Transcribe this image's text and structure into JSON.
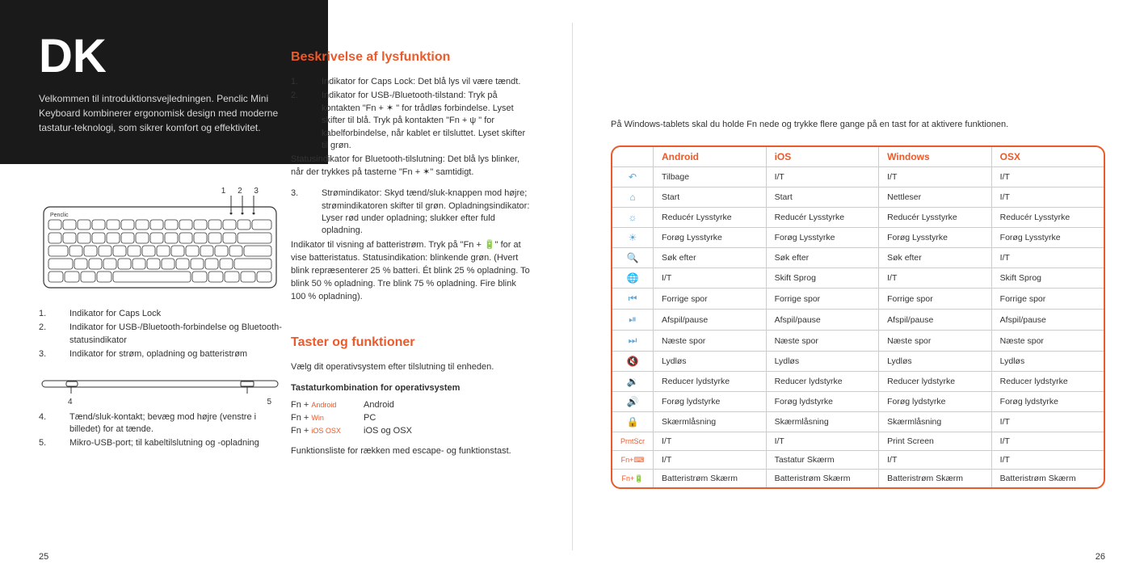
{
  "left": {
    "lang_code": "DK",
    "welcome": "Velkommen til introduktionsvejledningen. Penclic Mini Keyboard kombinerer ergonomisk design med moderne tastatur-teknologi, som sikrer komfort og effektivitet.",
    "kb_top_nums": "1   2   3",
    "kb_bottom_left": "4",
    "kb_bottom_right": "5",
    "indicators": [
      "Indikator for Caps Lock",
      "Indikator for USB-/Bluetooth-forbindelse og Bluetooth-statusindikator",
      "Indikator for strøm, opladning og batteristrøm"
    ],
    "bottom_items": [
      "Tænd/sluk-kontakt; bevæg mod højre (venstre i billedet) for at tænde.",
      "Mikro-USB-port; til kabeltilslutning og -opladning"
    ]
  },
  "mid": {
    "h_light": "Beskrivelse af lysfunktion",
    "light_items": [
      "Indikator for Caps Lock: Det blå lys vil være tændt.",
      "Indikator for USB-/Bluetooth-tilstand: Tryk på kontakten \"Fn + ✶ \" for trådløs forbindelse. Lyset skifter til blå. Tryk på kontakten \"Fn +  ψ \" for kabelforbindelse, når kablet er tilsluttet. Lyset skifter til grøn."
    ],
    "bt_status": "Statusindikator for Bluetooth-tilslutning: Det blå lys blinker, når der trykkes på tasterne \"Fn + ✶\" samtidigt.",
    "power_item": "Strømindikator: Skyd tænd/sluk-knappen mod højre; strømindikatoren skifter til grøn. Opladningsindikator: Lyser rød under opladning; slukker efter fuld opladning.",
    "battery_para": "Indikator til visning af batteristrøm. Tryk på \"Fn + 🔋\" for at vise batteristatus. Statusindikation: blinkende grøn. (Hvert blink repræsenterer 25 % batteri. Ét blink 25 % opladning. To blink 50 % opladning. Tre blink 75 % opladning. Fire blink 100 % opladning).",
    "h_keys": "Taster og funktioner",
    "choose_os": "Vælg dit operativsystem efter tilslutning til enheden.",
    "shortcut_head": "Tastaturkombination for operativsystem",
    "shortcuts": [
      {
        "combo_prefix": "Fn + ",
        "combo_os": "Android",
        "label": "Android"
      },
      {
        "combo_prefix": "Fn + ",
        "combo_os": "Win",
        "label": "PC"
      },
      {
        "combo_prefix": "Fn + ",
        "combo_os": "iOS OSX",
        "label": "iOS og OSX"
      }
    ],
    "fn_list_note": "Funktionsliste for rækken med escape- og funktionstast."
  },
  "right": {
    "intro": "På Windows-tablets skal du holde Fn nede og trykke flere gange på en tast for at aktivere funktionen.",
    "headers": [
      "",
      "Android",
      "iOS",
      "Windows",
      "OSX"
    ],
    "rows": [
      {
        "icon": "↶",
        "cells": [
          "Tilbage",
          "I/T",
          "I/T",
          "I/T"
        ]
      },
      {
        "icon": "⌂",
        "cells": [
          "Start",
          "Start",
          "Nettleser",
          "I/T"
        ]
      },
      {
        "icon": "☼",
        "cells": [
          "Reducér Lysstyrke",
          "Reducér Lysstyrke",
          "Reducér Lysstyrke",
          "Reducér Lysstyrke"
        ]
      },
      {
        "icon": "☀",
        "cells": [
          "Forøg Lysstyrke",
          "Forøg Lysstyrke",
          "Forøg Lysstyrke",
          "Forøg Lysstyrke"
        ]
      },
      {
        "icon": "🔍",
        "cells": [
          "Søk efter",
          "Søk efter",
          "Søk efter",
          "I/T"
        ]
      },
      {
        "icon": "🌐",
        "cells": [
          "I/T",
          "Skift Sprog",
          "I/T",
          "Skift Sprog"
        ]
      },
      {
        "icon": "⏮",
        "cells": [
          "Forrige spor",
          "Forrige spor",
          "Forrige spor",
          "Forrige spor"
        ]
      },
      {
        "icon": "⏯",
        "cells": [
          "Afspil/pause",
          "Afspil/pause",
          "Afspil/pause",
          "Afspil/pause"
        ]
      },
      {
        "icon": "⏭",
        "cells": [
          "Næste spor",
          "Næste spor",
          "Næste spor",
          "Næste spor"
        ]
      },
      {
        "icon": "🔇",
        "cells": [
          "Lydløs",
          "Lydløs",
          "Lydløs",
          "Lydløs"
        ]
      },
      {
        "icon": "🔉",
        "cells": [
          "Reducer lydstyrke",
          "Reducer lydstyrke",
          "Reducer lydstyrke",
          "Reducer lydstyrke"
        ]
      },
      {
        "icon": "🔊",
        "cells": [
          "Forøg lydstyrke",
          "Forøg lydstyrke",
          "Forøg lydstyrke",
          "Forøg lydstyrke"
        ]
      },
      {
        "icon": "🔒",
        "cells": [
          "Skærmlåsning",
          "Skærmlåsning",
          "Skærmlåsning",
          "I/T"
        ]
      },
      {
        "icon": "PrntScr",
        "orange": true,
        "cells": [
          "I/T",
          "I/T",
          "Print Screen",
          "I/T"
        ]
      },
      {
        "icon": "Fn+⌨",
        "orange": true,
        "cells": [
          "I/T",
          "Tastatur Skærm",
          "I/T",
          "I/T"
        ]
      },
      {
        "icon": "Fn+🔋",
        "orange": true,
        "cells": [
          "Batteristrøm Skærm",
          "Batteristrøm Skærm",
          "Batteristrøm Skærm",
          "Batteristrøm Skærm"
        ]
      }
    ]
  },
  "pages": {
    "left": "25",
    "right": "26"
  }
}
